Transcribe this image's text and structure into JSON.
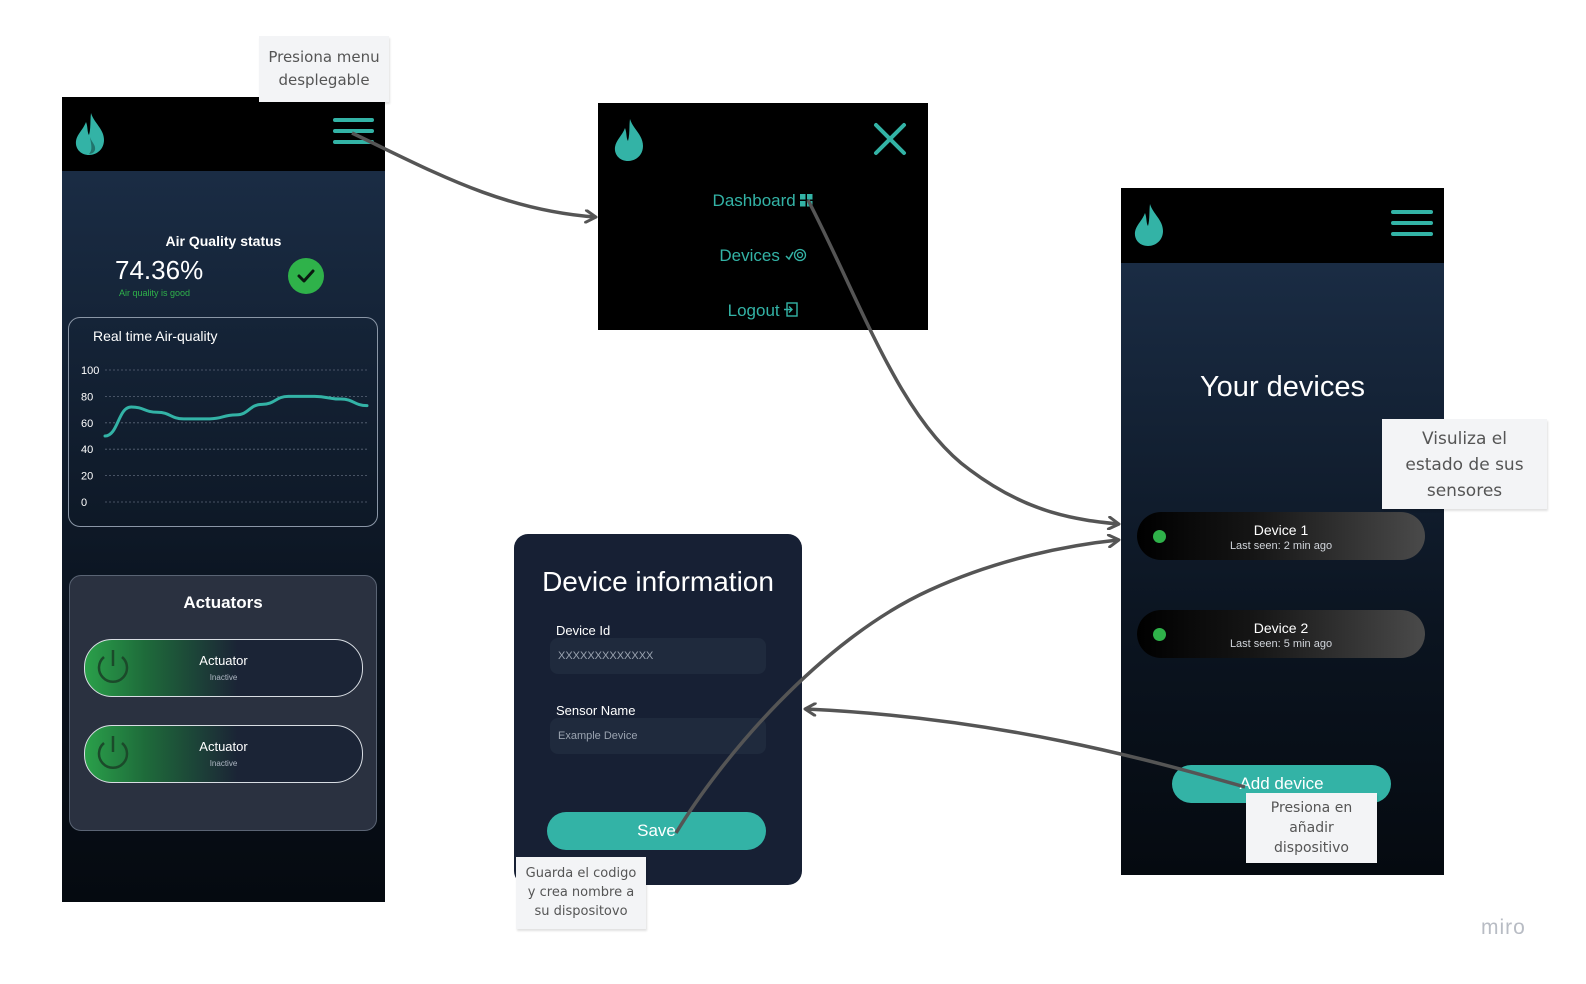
{
  "screen1": {
    "air_quality_title": "Air Quality status",
    "air_quality_value": "74.36%",
    "air_quality_sub": "Air quality is good",
    "chart_title": "Real time Air-quality",
    "actuators_title": "Actuators",
    "actuators": [
      {
        "label": "Actuator",
        "status": "Inactive"
      },
      {
        "label": "Actuator",
        "status": "Inactive"
      }
    ]
  },
  "menu": {
    "items": [
      {
        "label": "Dashboard"
      },
      {
        "label": "Devices"
      },
      {
        "label": "Logout"
      }
    ]
  },
  "devices_screen": {
    "title": "Your devices",
    "devices": [
      {
        "name": "Device 1",
        "last_seen": "Last seen: 2 min ago"
      },
      {
        "name": "Device 2",
        "last_seen": "Last seen: 5 min ago"
      }
    ],
    "add_button": "Add device"
  },
  "device_info": {
    "title": "Device information",
    "device_id_label": "Device Id",
    "device_id_placeholder": "XXXXXXXXXXXXX",
    "sensor_name_label": "Sensor Name",
    "sensor_name_placeholder": "Example Device",
    "save_label": "Save"
  },
  "notes": {
    "menu_note": "Presiona menu desplegable",
    "status_note": "Visuliza el estado de sus sensores",
    "add_note": "Presiona en añadir dispositivo",
    "save_note": "Guarda el codigo y crea nombre a su dispositovo"
  },
  "watermark": "miro",
  "colors": {
    "accent": "#33b3a6",
    "status_ok": "#2fb24a",
    "background_dark": "#000000"
  },
  "chart_data": {
    "type": "line",
    "title": "Real time Air-quality",
    "yticks": [
      0,
      20,
      40,
      60,
      80,
      100
    ],
    "ylim": [
      0,
      100
    ],
    "x": [
      0,
      1,
      2,
      3,
      4,
      5,
      6,
      7,
      8,
      9,
      10
    ],
    "series": [
      {
        "values": [
          50,
          72,
          68,
          63,
          63,
          66,
          74,
          80,
          80,
          78,
          73
        ]
      }
    ],
    "grid": true
  }
}
